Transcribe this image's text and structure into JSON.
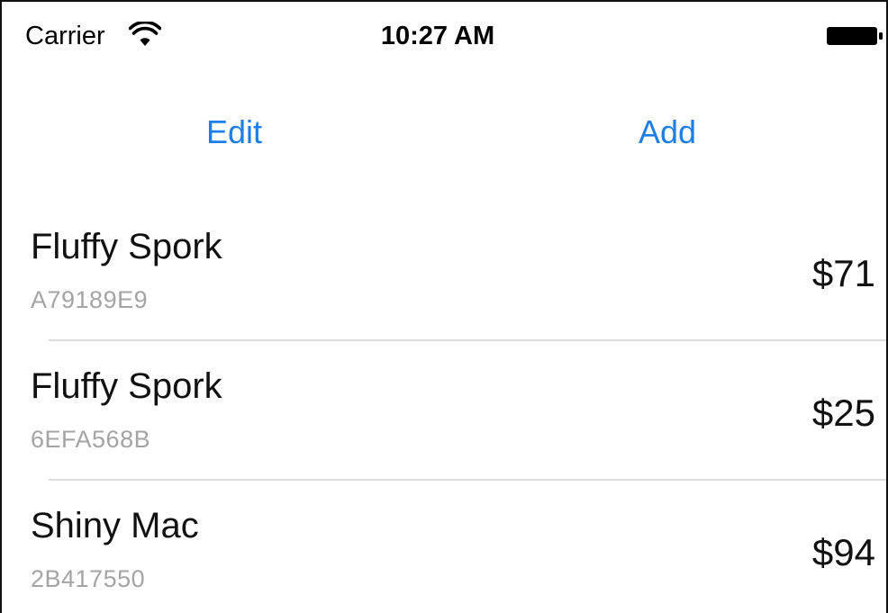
{
  "status_bar": {
    "carrier": "Carrier",
    "wifi_icon": "wifi-icon",
    "time": "10:27 AM",
    "battery_icon": "battery-icon"
  },
  "toolbar": {
    "edit_label": "Edit",
    "add_label": "Add"
  },
  "items": [
    {
      "name": "Fluffy Spork",
      "serial": "A79189E9",
      "price": "$71"
    },
    {
      "name": "Fluffy Spork",
      "serial": "6EFA568B",
      "price": "$25"
    },
    {
      "name": "Shiny Mac",
      "serial": "2B417550",
      "price": "$94"
    }
  ],
  "colors": {
    "accent": "#1e7ee6",
    "secondary_text": "#a4a4a4",
    "separator": "#dcdcdc"
  }
}
